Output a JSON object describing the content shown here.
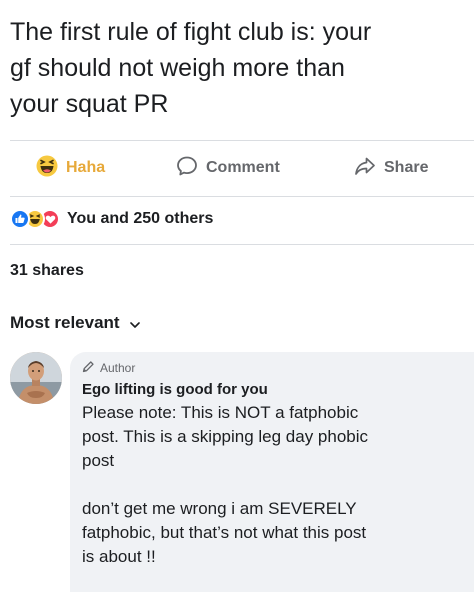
{
  "post": {
    "text": "The first rule of fight club is: your\ngf should not weigh more than\nyour squat PR"
  },
  "actions": {
    "haha_label": "Haha",
    "comment_label": "Comment",
    "share_label": "Share"
  },
  "reactions": {
    "icons": [
      "like-icon",
      "haha-icon",
      "love-icon"
    ],
    "summary": "You and 250 others"
  },
  "shares": "31 shares",
  "comments_sort": {
    "label": "Most relevant"
  },
  "comment": {
    "badge": "Author",
    "author_name": "Ego lifting is good for you",
    "text": "Please note: This is NOT a fatphobic\npost. This is a skipping leg day phobic\npost\n\ndon’t get me wrong i am SEVERELY\nfatphobic, but that’s not what this post\nis about !!"
  },
  "colors": {
    "haha": "#e7a93a",
    "like": "#1877f2",
    "love": "#f33e58",
    "secondary_text": "#65676b",
    "bubble": "#f0f2f5"
  }
}
